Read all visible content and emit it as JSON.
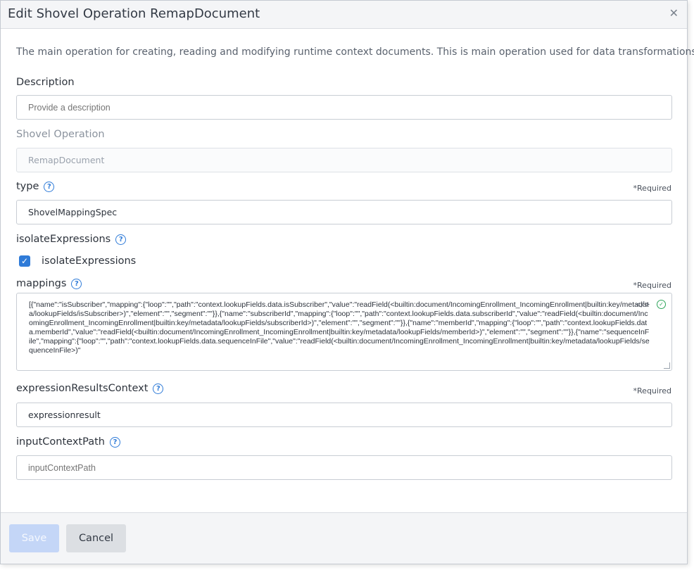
{
  "dialog": {
    "title": "Edit Shovel Operation RemapDocument",
    "close_icon": "close-icon",
    "intro": "The main operation for creating, reading and modifying runtime context documents. This is main operation used for data transformations."
  },
  "fields": {
    "description": {
      "label": "Description",
      "placeholder": "Provide a description"
    },
    "shovel_operation": {
      "label": "Shovel Operation",
      "value": "RemapDocument"
    },
    "type": {
      "label": "type",
      "required": "*Required",
      "value": "ShovelMappingSpec"
    },
    "isolate_expressions": {
      "label": "isolateExpressions",
      "checkbox_label": "isolateExpressions",
      "checked": true
    },
    "mappings": {
      "label": "mappings",
      "required": "*Required",
      "value": "[{\"name\":\"isSubscriber\",\"mapping\":{\"loop\":\"\",\"path\":\"context.lookupFields.data.isSubscriber\",\"value\":\"readField(<builtin:document/IncomingEnrollment_IncomingEnrollment|builtin:key/metadata/lookupFields/isSubscriber>)\",\"element\":\"\",\"segment\":\"\"}},{\"name\":\"subscriberId\",\"mapping\":{\"loop\":\"\",\"path\":\"context.lookupFields.data.subscriberId\",\"value\":\"readField(<builtin:document/IncomingEnrollment_IncomingEnrollment|builtin:key/metadata/lookupFields/subscriberId>)\",\"element\":\"\",\"segment\":\"\"}},{\"name\":\"memberId\",\"mapping\":{\"loop\":\"\",\"path\":\"context.lookupFields.data.memberId\",\"value\":\"readField(<builtin:document/IncomingEnrollment_IncomingEnrollment|builtin:key/metadata/lookupFields/memberId>)\",\"element\":\"\",\"segment\":\"\"}},{\"name\":\"sequenceInFile\",\"mapping\":{\"loop\":\"\",\"path\":\"context.lookupFields.data.sequenceInFile\",\"value\":\"readField(<builtin:document/IncomingEnrollment_IncomingEnrollment|builtin:key/metadata/lookupFields/sequenceInFile>)\"",
      "code_icon": "</>",
      "valid_icon": "✓"
    },
    "expression_results_context": {
      "label": "expressionResultsContext",
      "required": "*Required",
      "value": "expressionresult"
    },
    "input_context_path": {
      "label": "inputContextPath",
      "placeholder": "inputContextPath"
    }
  },
  "footer": {
    "save_label": "Save",
    "cancel_label": "Cancel"
  },
  "colors": {
    "accent": "#2f7bd8",
    "valid": "#2ea55a",
    "save_disabled": "#c4d6f7"
  }
}
